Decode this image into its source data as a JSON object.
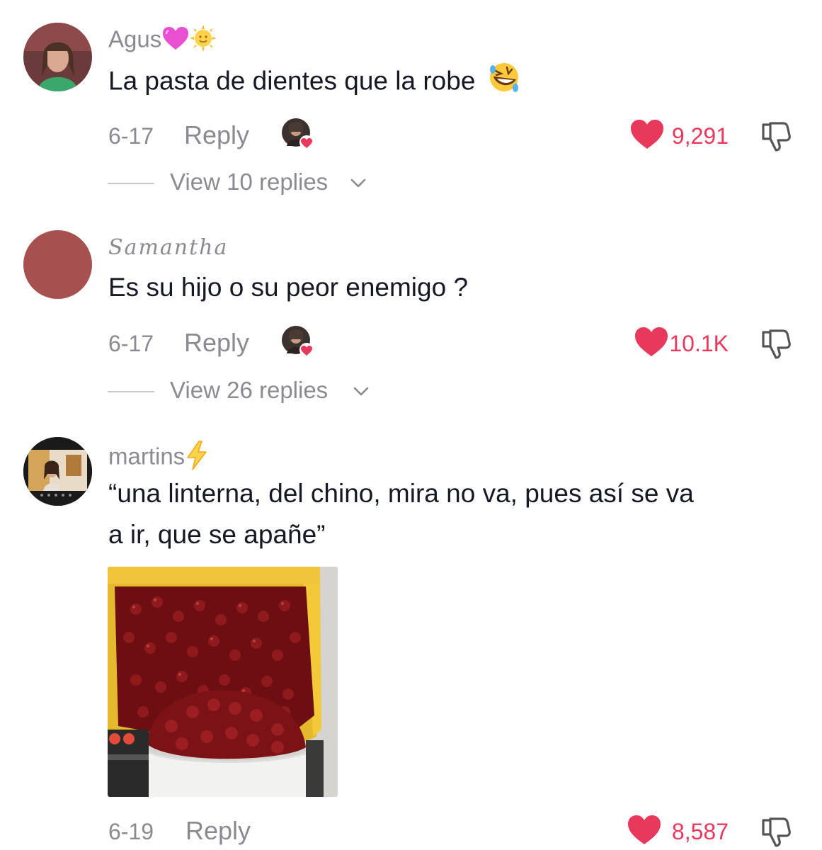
{
  "comments": [
    {
      "username": "Agus",
      "username_emojis": [
        "purple-heart-emoji",
        "sun-with-face-emoji"
      ],
      "text": "La pasta de dientes que la robe",
      "text_emoji": "rolling-on-floor-laughing-emoji",
      "date": "6-17",
      "reply_label": "Reply",
      "likes": "9,291",
      "view_replies": "View 10 replies"
    },
    {
      "username": "Samantha",
      "text": "Es su hijo o su peor enemigo ?",
      "date": "6-17",
      "reply_label": "Reply",
      "likes": "10.1K",
      "view_replies": "View 26 replies"
    },
    {
      "username": "martins",
      "username_emojis": [
        "lightning-emoji"
      ],
      "text_line1": "“una linterna, del chino, mira no va, pues así se va",
      "text_line2": "a ir, que se apañe”",
      "attachment": "cherries-truck-photo",
      "date": "6-19",
      "reply_label": "Reply",
      "likes": "8,587"
    }
  ],
  "colors": {
    "like_red": "#e8395d",
    "meta_gray": "#8a8b91",
    "text_dark": "#161823"
  }
}
